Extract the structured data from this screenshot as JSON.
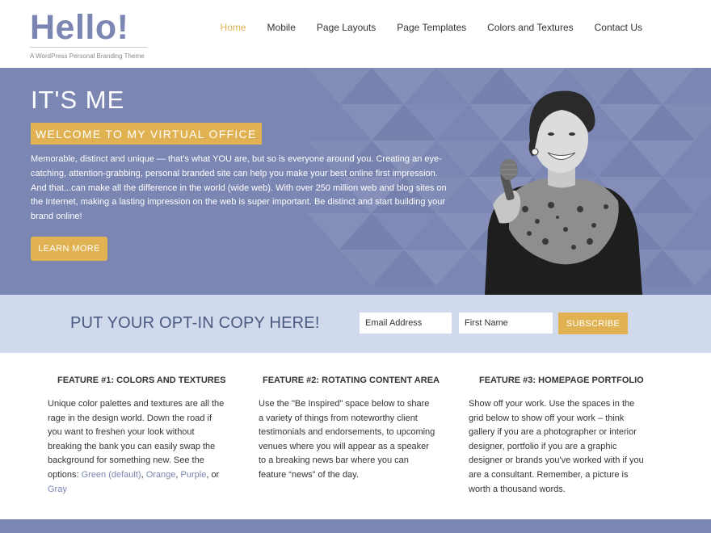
{
  "header": {
    "logo_title": "Hello!",
    "tagline": "A WordPress Personal Branding Theme",
    "nav": [
      "Home",
      "Mobile",
      "Page Layouts",
      "Page Templates",
      "Colors and Textures",
      "Contact Us"
    ]
  },
  "hero": {
    "title": "IT'S ME",
    "badge": "WELCOME TO MY VIRTUAL OFFICE",
    "text": "Memorable, distinct and unique — that's what YOU are, but so is everyone around you. Creating an eye-catching, attention-grabbing, personal branded site can help you make your best online first impression. And that...can make all the difference in the world (wide web). With over 250 million web and blog sites on the Internet, making a lasting impression on the web is super important. Be distinct and start building your brand online!",
    "button": "LEARN MORE"
  },
  "optin": {
    "heading": "PUT YOUR OPT-IN COPY HERE!",
    "email_placeholder": "Email Address",
    "first_placeholder": "First Name",
    "subscribe": "SUBSCRIBE"
  },
  "features": [
    {
      "title": "FEATURE #1: COLORS AND TEXTURES",
      "text": "Unique color palettes and textures are all the rage in the design world. Down the road if you want to freshen your look without breaking the bank you can easily swap the background for something new. See the options: ",
      "links": [
        "Green (default)",
        "Orange",
        "Purple",
        "Gray"
      ],
      "sep1": ", ",
      "sep2": ", ",
      "sep3": ", or "
    },
    {
      "title": "FEATURE #2: ROTATING CONTENT AREA",
      "text": "Use the \"Be Inspired\" space below to share a variety of things from noteworthy client testimonials and endorsements, to upcoming venues where you will appear as a speaker to a breaking news bar where you can feature “news” of the day."
    },
    {
      "title": "FEATURE #3: HOMEPAGE PORTFOLIO",
      "text": "Show off your work. Use the spaces in the grid below to show off your work – think gallery if you are a photographer or interior designer, portfolio if you are a graphic designer or brands you've worked with if you are a consultant. Remember, a picture is worth a thousand words."
    }
  ],
  "colors": {
    "accent": "#e0b252",
    "brand": "#7b86b3",
    "optin_bg": "#d1d9ec"
  }
}
